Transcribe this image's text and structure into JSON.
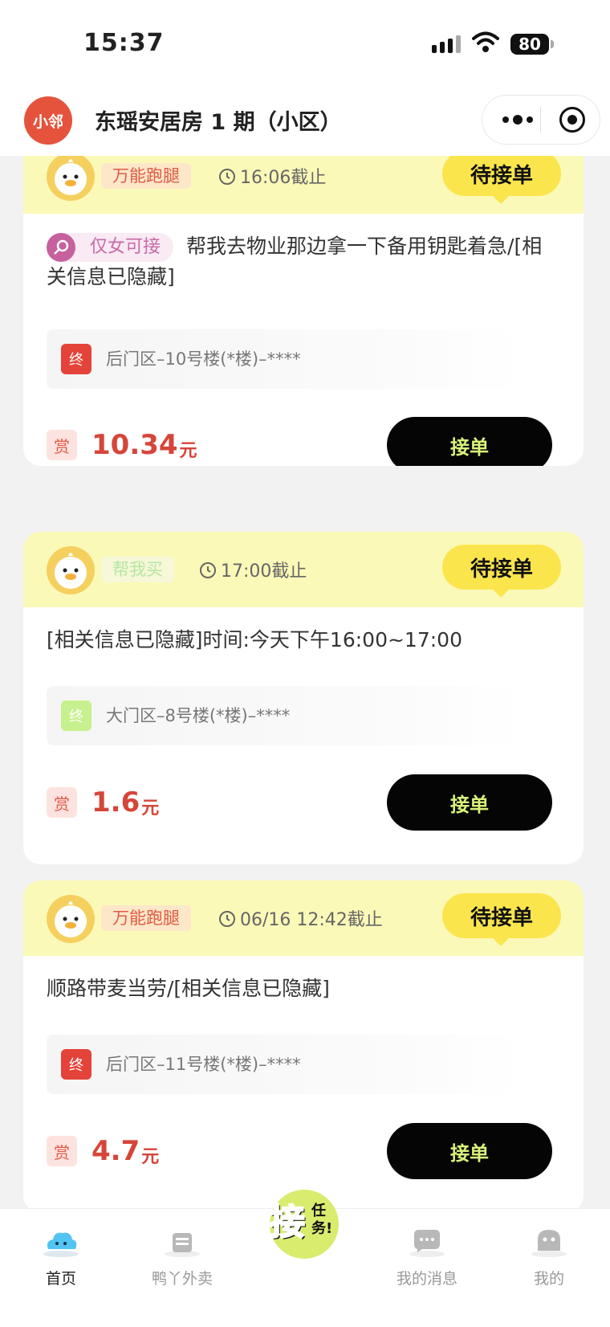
{
  "status_bar": {
    "time": "15:37",
    "battery": "80"
  },
  "nav": {
    "logo": "小邻",
    "title": "东瑶安居房 1 期（小区）"
  },
  "cards": [
    {
      "category": "万能跑腿",
      "deadline": "16:06截止",
      "status": "待接单",
      "badge": "仅女可接",
      "description": "帮我去物业那边拿一下备用钥匙着急/[相关信息已隐藏]",
      "end_label": "终",
      "address": "后门区–10号楼(*楼)–****",
      "reward_label": "赏",
      "amount": "10.34",
      "unit": "元",
      "action": "接单"
    },
    {
      "category": "帮我买",
      "deadline": "17:00截止",
      "status": "待接单",
      "description": "[相关信息已隐藏]时间:今天下午16:00~17:00",
      "end_label": "终",
      "address": "大门区–8号楼(*楼)–****",
      "reward_label": "赏",
      "amount": "1.6",
      "unit": "元",
      "action": "接单"
    },
    {
      "category": "万能跑腿",
      "deadline": "06/16 12:42截止",
      "status": "待接单",
      "description": "顺路带麦当劳/[相关信息已隐藏]",
      "end_label": "终",
      "address": "后门区–11号楼(*楼)–****",
      "reward_label": "赏",
      "amount": "4.7",
      "unit": "元",
      "action": "接单"
    }
  ],
  "tabbar": {
    "home": "首页",
    "takeaway": "鸭丫外卖",
    "center_main": "接",
    "center_small": "任务!",
    "messages": "我的消息",
    "mine": "我的"
  },
  "colors": {
    "accent_yellow": "#fbe54d",
    "price_red": "#d6453a",
    "card_header": "#fbf9b8",
    "button_text": "#d8f27a"
  }
}
